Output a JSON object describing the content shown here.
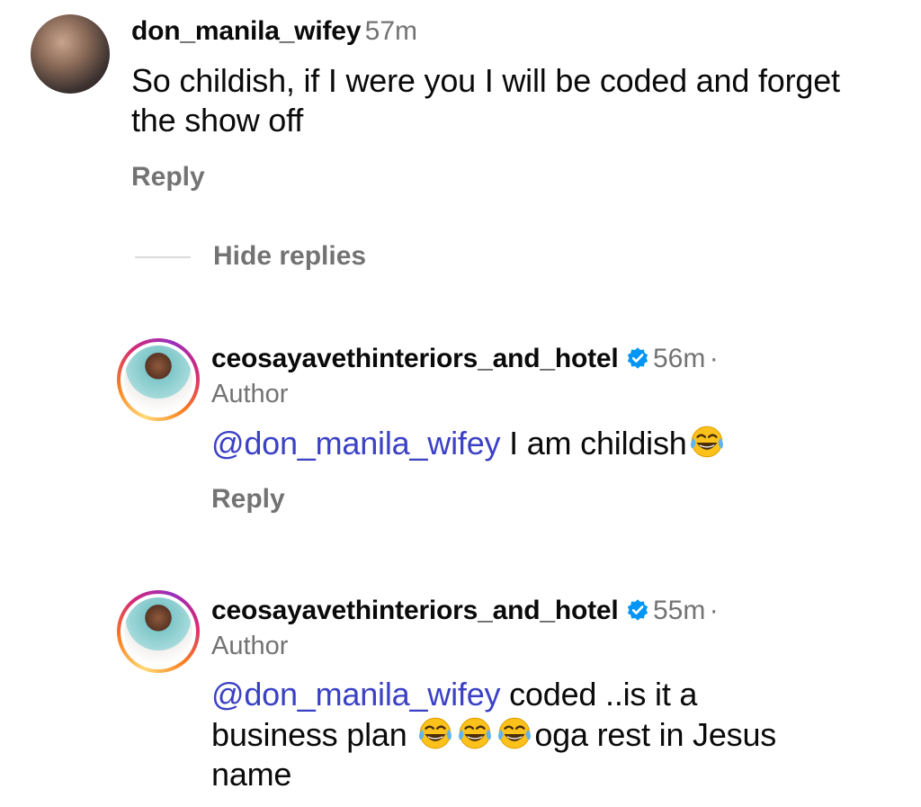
{
  "top_comment": {
    "username": "don_manila_wifey",
    "time": "57m",
    "text": "So childish, if I were you I will be coded and forget the show off",
    "reply_label": "Reply",
    "avatar_icon": "user-photo-avatar"
  },
  "hide_replies_label": "Hide replies",
  "replies": [
    {
      "username": "ceosayavethinteriors_and_hotel",
      "verified": true,
      "time": "56m",
      "separator": "·",
      "author_label": "Author",
      "mention": "@don_manila_wifey",
      "text": " I am childish",
      "emoji_count": 1,
      "reply_label": "Reply"
    },
    {
      "username": "ceosayavethinteriors_and_hotel",
      "verified": true,
      "time": "55m",
      "separator": "·",
      "author_label": "Author",
      "mention": "@don_manila_wifey",
      "text_line1": " coded ..is it a",
      "text_line2_a": "business plan ",
      "text_line2_b": "oga rest in Jesus",
      "text_line3": "name",
      "emoji_count": 3
    }
  ],
  "colors": {
    "mention": "#3b41c5",
    "muted": "#737373",
    "verified": "#0095f6",
    "ring_gradient": [
      "#feda75",
      "#fa7e1e",
      "#d62976",
      "#962fbf"
    ]
  },
  "icons": {
    "verified": "verified-badge-icon",
    "emoji": "tears-of-joy-emoji"
  }
}
